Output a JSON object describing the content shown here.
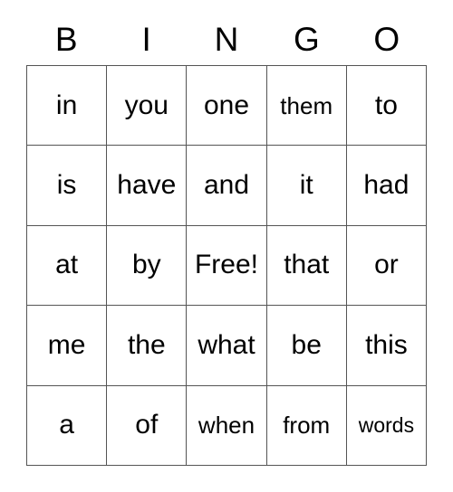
{
  "card": {
    "headers": [
      "B",
      "I",
      "N",
      "G",
      "O"
    ],
    "rows": [
      [
        "in",
        "you",
        "one",
        "them",
        "to"
      ],
      [
        "is",
        "have",
        "and",
        "it",
        "had"
      ],
      [
        "at",
        "by",
        "Free!",
        "that",
        "or"
      ],
      [
        "me",
        "the",
        "what",
        "be",
        "this"
      ],
      [
        "a",
        "of",
        "when",
        "from",
        "words"
      ]
    ],
    "free_space": "Free!",
    "colors": {
      "background": "#ffffff",
      "text": "#000000",
      "grid_line": "#555555"
    }
  }
}
